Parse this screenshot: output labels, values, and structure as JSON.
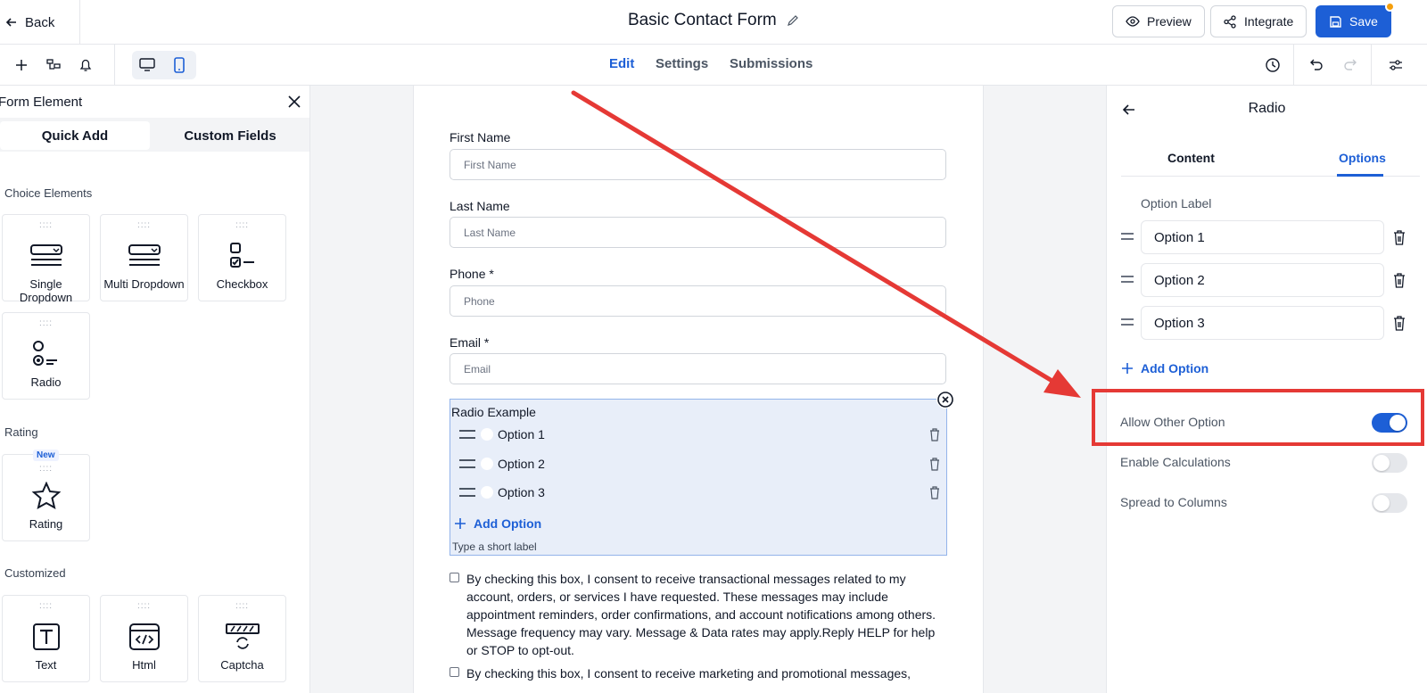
{
  "header": {
    "back_label": "Back",
    "title": "Basic Contact Form",
    "preview_label": "Preview",
    "integrate_label": "Integrate",
    "save_label": "Save"
  },
  "toolbar": {
    "tabs": [
      {
        "label": "Edit",
        "active": true
      },
      {
        "label": "Settings",
        "active": false
      },
      {
        "label": "Submissions",
        "active": false
      }
    ],
    "view_mode": "mobile"
  },
  "left_panel": {
    "title": "Form Element",
    "tabs": [
      "Quick Add",
      "Custom Fields"
    ],
    "active_tab": "Quick Add",
    "sections": [
      {
        "title": "Choice Elements",
        "items": [
          "Single Dropdown",
          "Multi Dropdown",
          "Checkbox",
          "Radio"
        ]
      },
      {
        "title": "Rating",
        "items": [
          "Rating"
        ],
        "badge": "New"
      },
      {
        "title": "Customized",
        "items": [
          "Text",
          "Html",
          "Captcha"
        ]
      }
    ]
  },
  "form": {
    "fields": [
      {
        "label": "First Name",
        "placeholder": "First Name"
      },
      {
        "label": "Last Name",
        "placeholder": "Last Name"
      },
      {
        "label": "Phone *",
        "placeholder": "Phone"
      },
      {
        "label": "Email *",
        "placeholder": "Email"
      }
    ],
    "radio": {
      "title": "Radio Example",
      "options": [
        "Option 1",
        "Option 2",
        "Option 3"
      ],
      "add_label": "Add Option",
      "hint": "Type a short label"
    },
    "consents": [
      "By checking this box, I consent to receive transactional messages related to my account, orders, or services I have requested. These messages may include appointment reminders, order confirmations, and account notifications among others. Message frequency may vary. Message & Data rates may apply.Reply HELP for help or STOP to opt-out.",
      "By checking this box, I consent to receive marketing and promotional messages,"
    ]
  },
  "right_panel": {
    "title": "Radio",
    "tabs": [
      "Content",
      "Options"
    ],
    "active_tab": "Options",
    "option_label_heading": "Option Label",
    "options": [
      "Option 1",
      "Option 2",
      "Option 3"
    ],
    "add_option_label": "Add Option",
    "toggles": [
      {
        "label": "Allow Other Option",
        "on": true
      },
      {
        "label": "Enable Calculations",
        "on": false
      },
      {
        "label": "Spread to Columns",
        "on": false
      }
    ]
  },
  "colors": {
    "accent": "#1d5fd6",
    "annotation": "#e53935",
    "notification_dot": "#f59e0b"
  }
}
